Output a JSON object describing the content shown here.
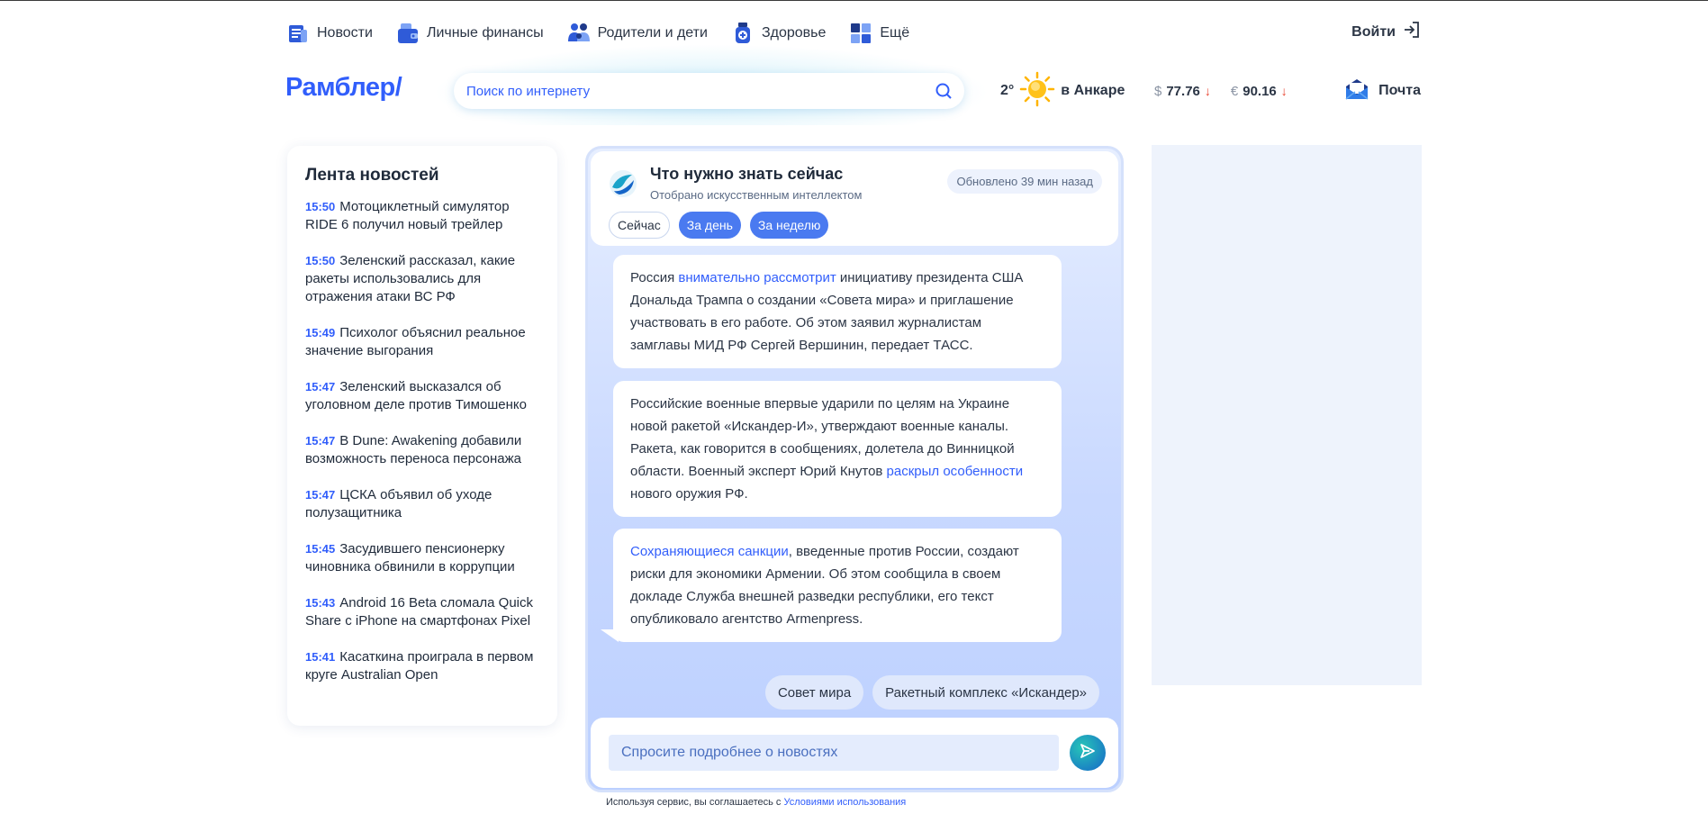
{
  "nav": {
    "items": [
      {
        "label": "Новости",
        "icon": "news-icon"
      },
      {
        "label": "Личные финансы",
        "icon": "wallet-icon"
      },
      {
        "label": "Родители и дети",
        "icon": "family-icon"
      },
      {
        "label": "Здоровье",
        "icon": "medicine-icon"
      },
      {
        "label": "Ещё",
        "icon": "grid-icon"
      }
    ],
    "login_label": "Войти"
  },
  "header": {
    "logo": "Рамблер/",
    "search_placeholder": "Поиск по интернету",
    "weather": {
      "temp": "2°",
      "city": "в Анкаре",
      "icon": "sun-icon"
    },
    "rates": [
      {
        "symbol": "$",
        "value": "77.76",
        "trend": "↓"
      },
      {
        "symbol": "€",
        "value": "90.16",
        "trend": "↓"
      }
    ],
    "mail_label": "Почта"
  },
  "feed": {
    "title": "Лента новостей",
    "items": [
      {
        "time": "15:50",
        "text": "Мотоциклетный симулятор RIDE 6 получил новый трейлер"
      },
      {
        "time": "15:50",
        "text": "Зеленский рассказал, какие ракеты использовались для отражения атаки ВС РФ"
      },
      {
        "time": "15:49",
        "text": "Психолог объяснил реальное значение выгорания"
      },
      {
        "time": "15:47",
        "text": "Зеленский высказался об уголовном деле против Тимошенко"
      },
      {
        "time": "15:47",
        "text": "В Dune: Awakening добавили возможность переноса персонажа"
      },
      {
        "time": "15:47",
        "text": "ЦСКА объявил об уходе полузащитника"
      },
      {
        "time": "15:45",
        "text": "Засудившего пенсионерку чиновника обвинили в коррупции"
      },
      {
        "time": "15:43",
        "text": "Android 16 Beta сломала Quick Share с iPhone на смартфонах Pixel"
      },
      {
        "time": "15:41",
        "text": "Касаткина проиграла в первом круге Australian Open"
      }
    ]
  },
  "ai": {
    "title": "Что нужно знать сейчас",
    "subtitle": "Отобрано искусственным интеллектом",
    "updated": "Обновлено 39 мин назад",
    "tabs": [
      "Сейчас",
      "За день",
      "За неделю"
    ],
    "messages": [
      {
        "pre": "Россия ",
        "link": "внимательно рассмотрит",
        "post": " инициативу президента США Дональда Трампа о создании «Совета мира» и приглашение участвовать в его работе. Об этом заявил журналистам замглавы МИД РФ Сергей Вершинин, передает ТАСС."
      },
      {
        "pre": "Российские военные впервые ударили по целям на Украине новой ракетой «Искандер-И», утверждают военные каналы. Ракета, как говорится в сообщениях, долетела до Винницкой области. Военный эксперт Юрий Кнутов ",
        "link": "раскрыл особенности",
        "post": " нового оружия РФ."
      },
      {
        "pre": "",
        "link": "Сохраняющиеся санкции",
        "post": ", введенные против России, создают риски для экономики Армении. Об этом сообщила в своем докладе Служба внешней разведки республики, его текст опубликовало агентство Armenpress."
      }
    ],
    "chips": [
      "Совет мира",
      "Ракетный комплекс «Искандер»"
    ],
    "ask_placeholder": "Спросите подробнее о новостях"
  },
  "terms": {
    "text": "Используя сервис, вы соглашаетесь с ",
    "link": "Условиями использования"
  },
  "colors": {
    "brand": "#315efb",
    "accent_tab": "#4a7af0",
    "rate_down": "#e8412c"
  }
}
